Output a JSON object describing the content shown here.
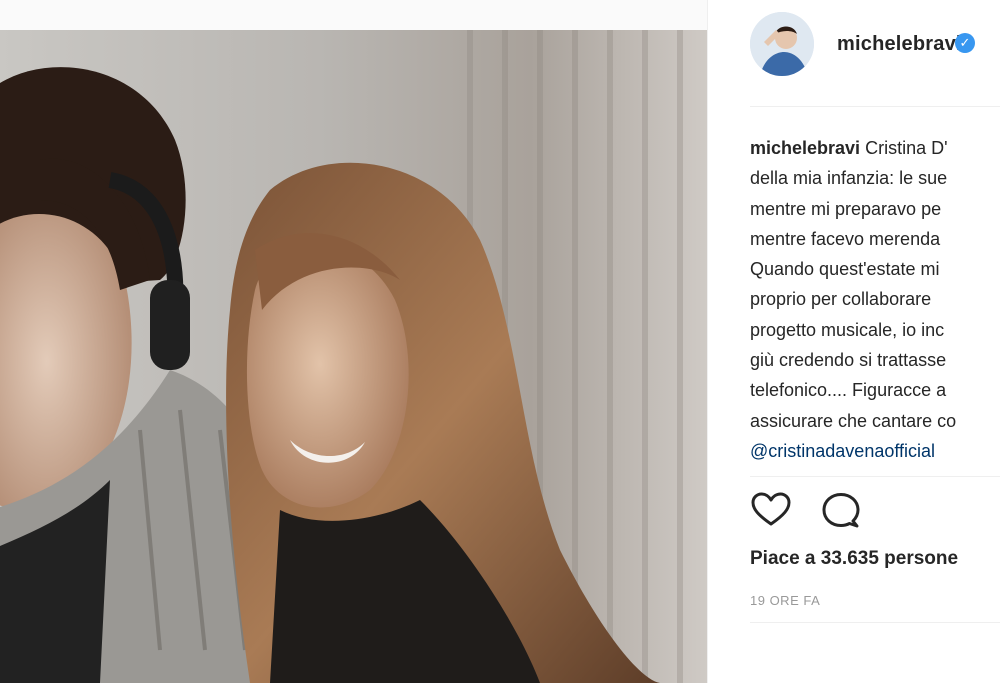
{
  "post": {
    "username": "michelebravi",
    "verified": true,
    "caption_author": "michelebravi",
    "caption_lines": [
      "Cristina D'",
      "della mia infanzia: le sue",
      "mentre mi preparavo pe",
      "mentre facevo merenda",
      "Quando quest'estate mi",
      "proprio per collaborare",
      "progetto musicale, io inc",
      "giù credendo si trattasse",
      "telefonico.... Figuracce a",
      "assicurare che cantare co"
    ],
    "caption_mention": "@cristinadavenaofficial",
    "likes_text": "Piace a 33.635 persone",
    "timestamp": "19 ORE FA"
  },
  "icons": {
    "like": "heart-icon",
    "comment": "comment-icon",
    "verified": "verified-badge-icon"
  },
  "colors": {
    "verified_blue": "#3897f0",
    "mention": "#003569",
    "text": "#262626",
    "muted": "#999999"
  }
}
